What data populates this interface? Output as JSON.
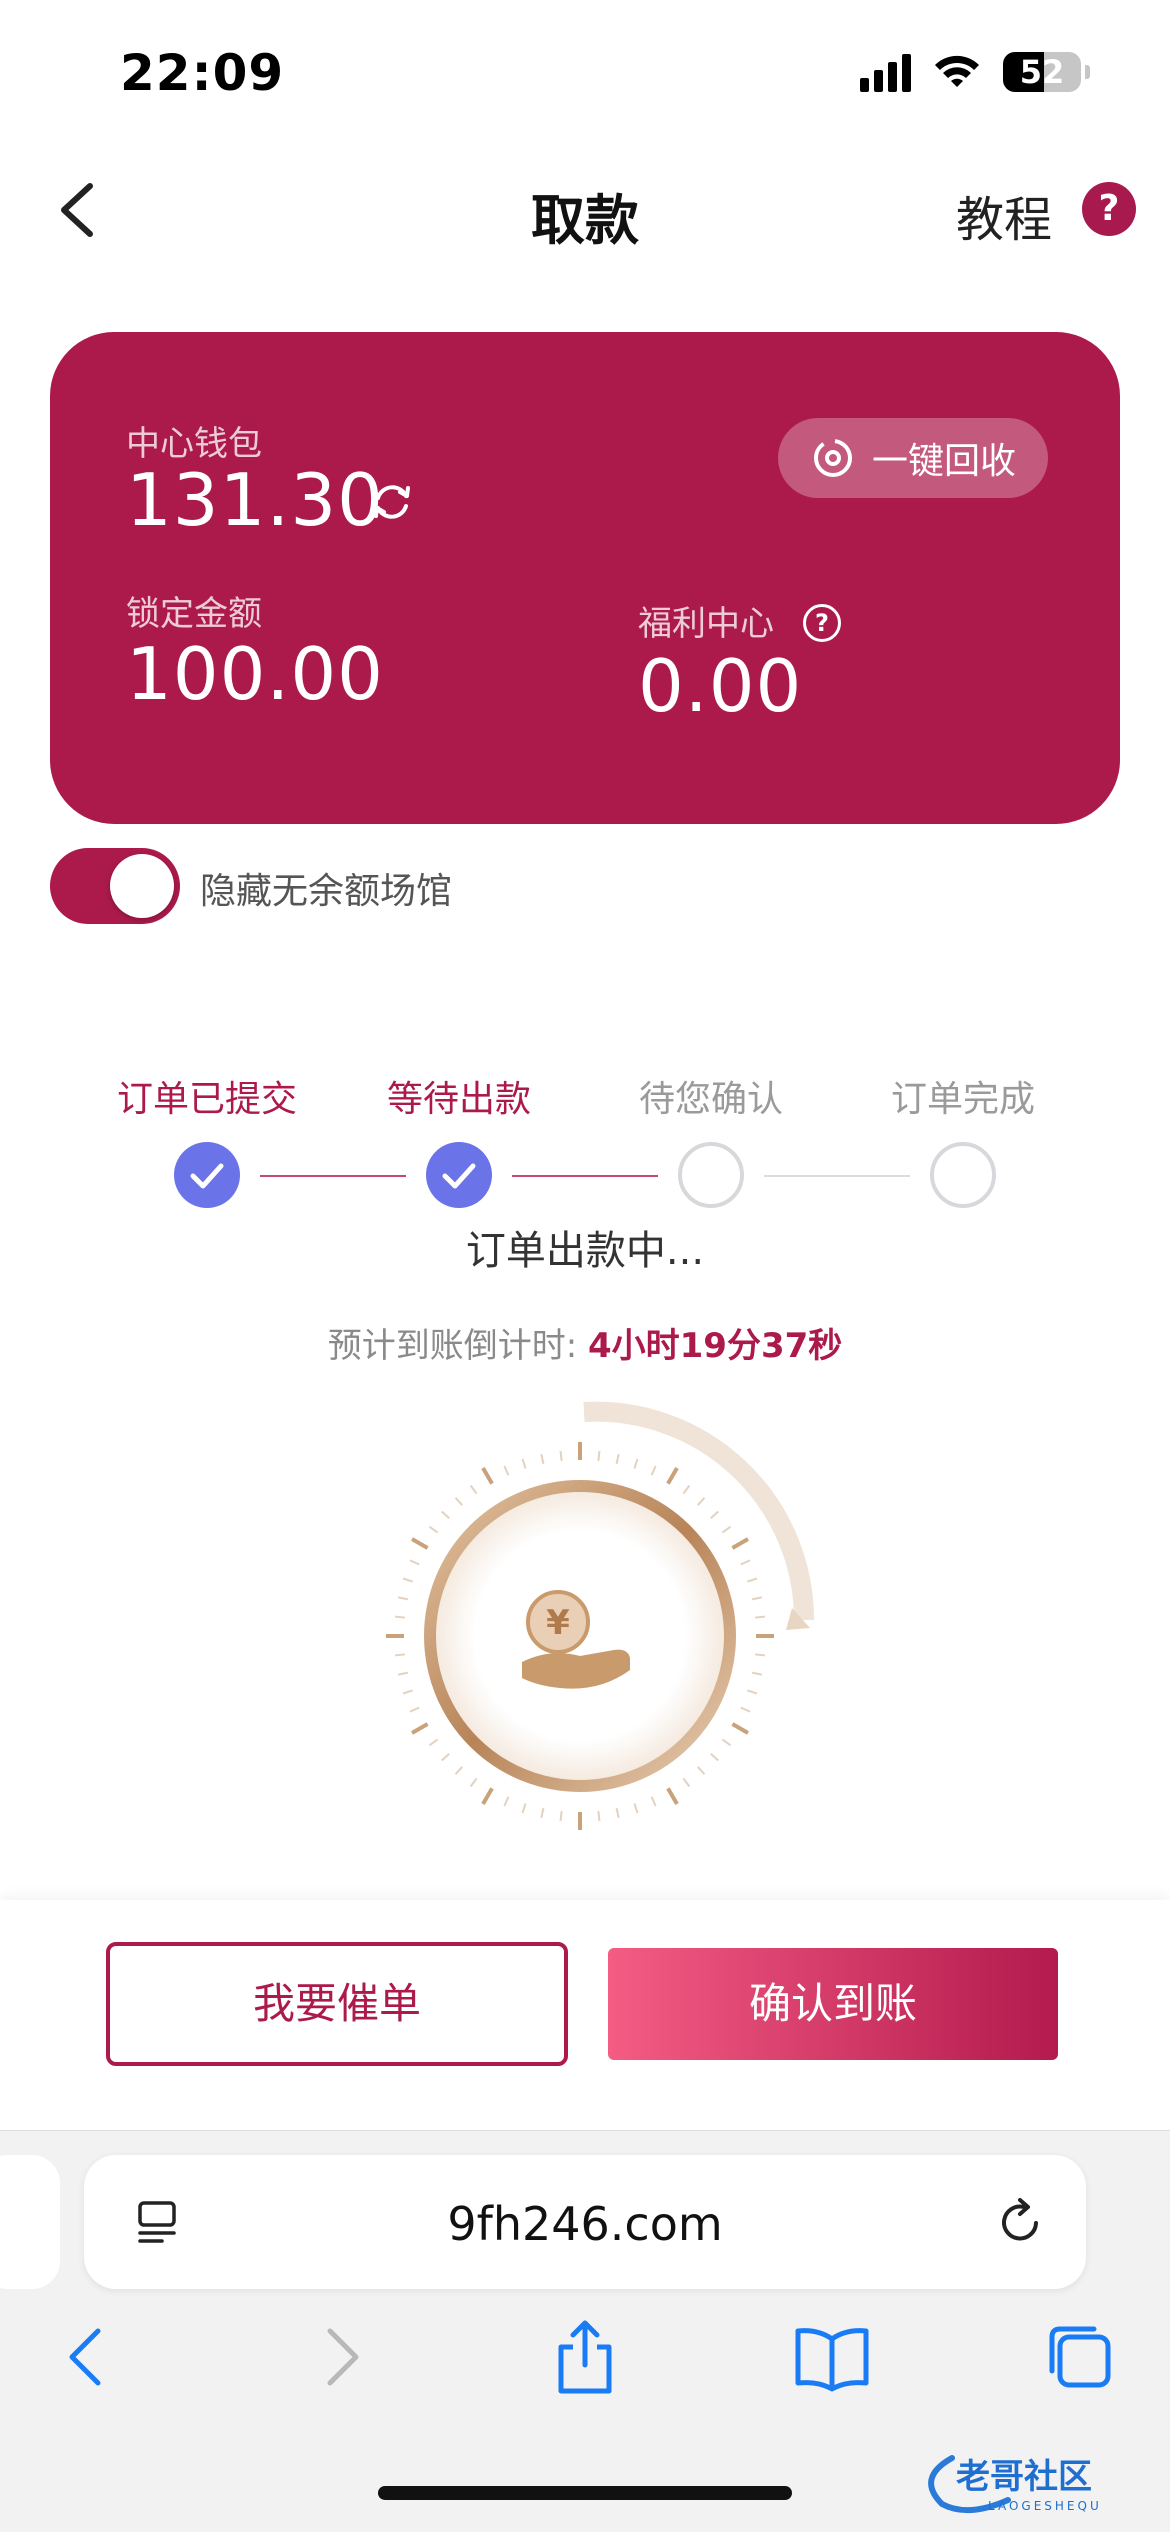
{
  "status_bar": {
    "time": "22:09",
    "battery": "52"
  },
  "nav": {
    "title": "取款",
    "tutorial": "教程",
    "help_icon": "?"
  },
  "wallet": {
    "center_label": "中心钱包",
    "center_value": "131.30",
    "recycle_label": "一键回收",
    "locked_label": "锁定金额",
    "locked_value": "100.00",
    "welfare_label": "福利中心",
    "welfare_value": "0.00",
    "welfare_help": "?"
  },
  "toggle": {
    "label": "隐藏无余额场馆",
    "on": true
  },
  "progress": {
    "steps": [
      {
        "label": "订单已提交",
        "done": true
      },
      {
        "label": "等待出款",
        "done": true
      },
      {
        "label": "待您确认",
        "done": false
      },
      {
        "label": "订单完成",
        "done": false
      }
    ],
    "status": "订单出款中...",
    "eta_label": "预计到账倒计时:",
    "eta_value": "4小时19分37秒"
  },
  "actions": {
    "urge": "我要催单",
    "confirm": "确认到账"
  },
  "browser": {
    "url": "9fh246.com"
  },
  "watermark": {
    "text": "老哥社区",
    "subtext": "LAOGESHEQU"
  },
  "colors": {
    "brand": "#ac1a4c",
    "step_done": "#6a73e8",
    "gold": "#c99a6b"
  }
}
